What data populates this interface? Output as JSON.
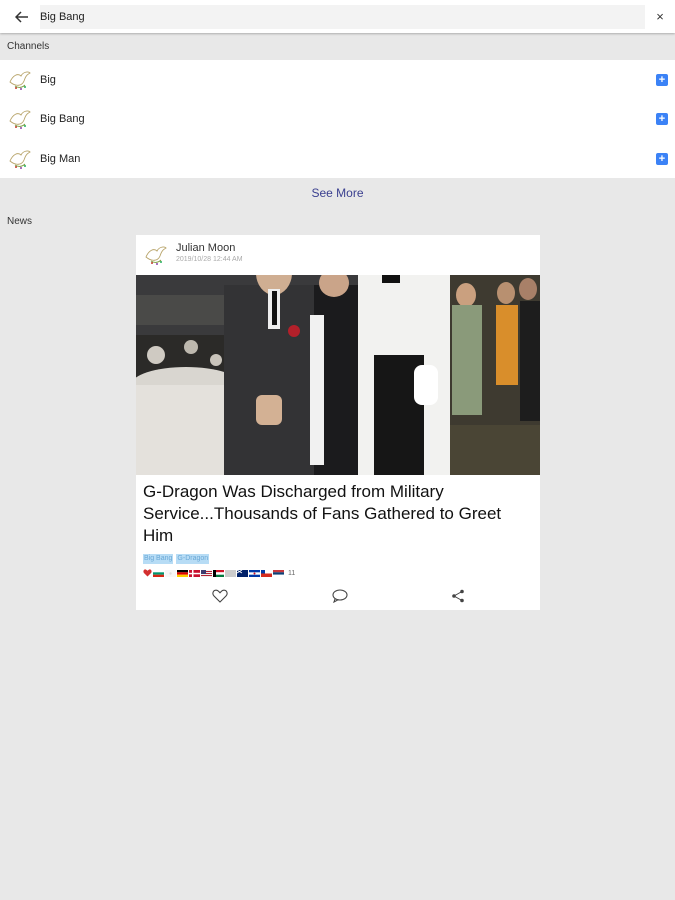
{
  "search": {
    "query": "Big Bang",
    "clear_symbol": "×"
  },
  "sections": {
    "channels": "Channels",
    "news": "News"
  },
  "channels": [
    {
      "name": "Big"
    },
    {
      "name": "Big Bang"
    },
    {
      "name": "Big Man"
    }
  ],
  "see_more": "See More",
  "news": [
    {
      "author": "Julian Moon",
      "time": "2019/10/28 12:44 AM",
      "headline": "G-Dragon Was Discharged from Military Service...Thousands of Fans Gathered to Greet Him",
      "tags": [
        "Big Bang",
        "G-Dragon"
      ],
      "reaction_count": "11"
    }
  ],
  "colors": {
    "accent": "#3b82f6",
    "link": "#3a3f8f",
    "tag_bg": "#b7dcf5",
    "background": "#e8e8e8"
  },
  "icons": [
    "back-arrow-icon",
    "close-icon",
    "dove-logo-icon",
    "add-icon",
    "heart-icon",
    "comment-icon",
    "share-icon"
  ]
}
